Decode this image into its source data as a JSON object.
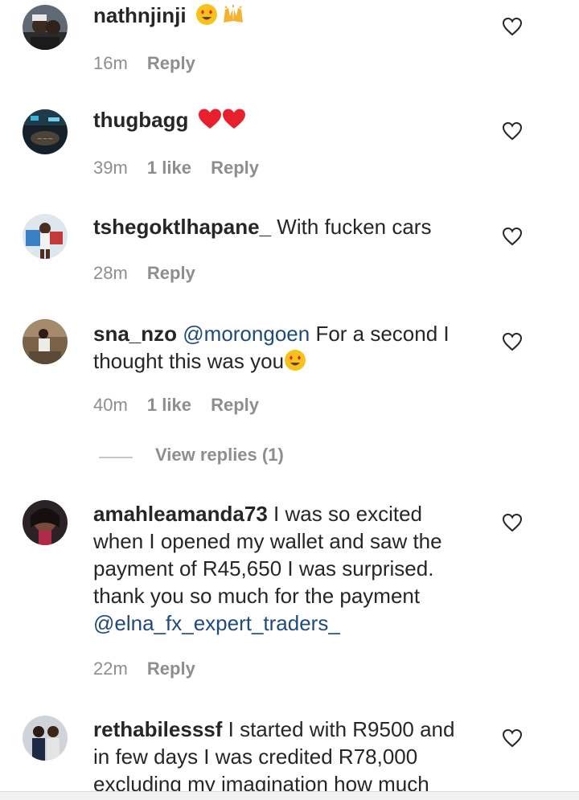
{
  "comments": [
    {
      "username": "nathnjinji",
      "text": "",
      "emoji": [
        "heart-eyes",
        "raised-hands"
      ],
      "time": "16m",
      "likes": "",
      "reply": "Reply"
    },
    {
      "username": "thugbagg",
      "text": "",
      "emoji": [
        "red-heart",
        "red-heart"
      ],
      "time": "39m",
      "likes": "1 like",
      "reply": "Reply"
    },
    {
      "username": "tshegoktlhapane_",
      "text": "With fucken cars",
      "emoji": [],
      "time": "28m",
      "likes": "",
      "reply": "Reply"
    },
    {
      "username": "sna_nzo",
      "mention": "@morongoen",
      "text": "For a second I thought this was you",
      "emoji": [
        "heart-eyes"
      ],
      "time": "40m",
      "likes": "1 like",
      "reply": "Reply"
    },
    {
      "username": "amahleamanda73",
      "text": "I was so excited when I opened my wallet and saw the payment of R45,650 I was surprised. thank you so much for the payment",
      "mention_after": "@elna_fx_expert_traders_",
      "emoji": [],
      "time": "22m",
      "likes": "",
      "reply": "Reply"
    },
    {
      "username": "rethabilesssf",
      "text": "I started with R9500 and in few days I was credited R78,000 excluding my imagination how much",
      "emoji": [],
      "time": "",
      "likes": "",
      "reply": ""
    }
  ],
  "view_replies": "View replies (1)",
  "colors": {
    "text": "#262626",
    "meta": "#8e8e8e",
    "mention": "#1f4a7c",
    "emoji_red": "#e8202e"
  }
}
